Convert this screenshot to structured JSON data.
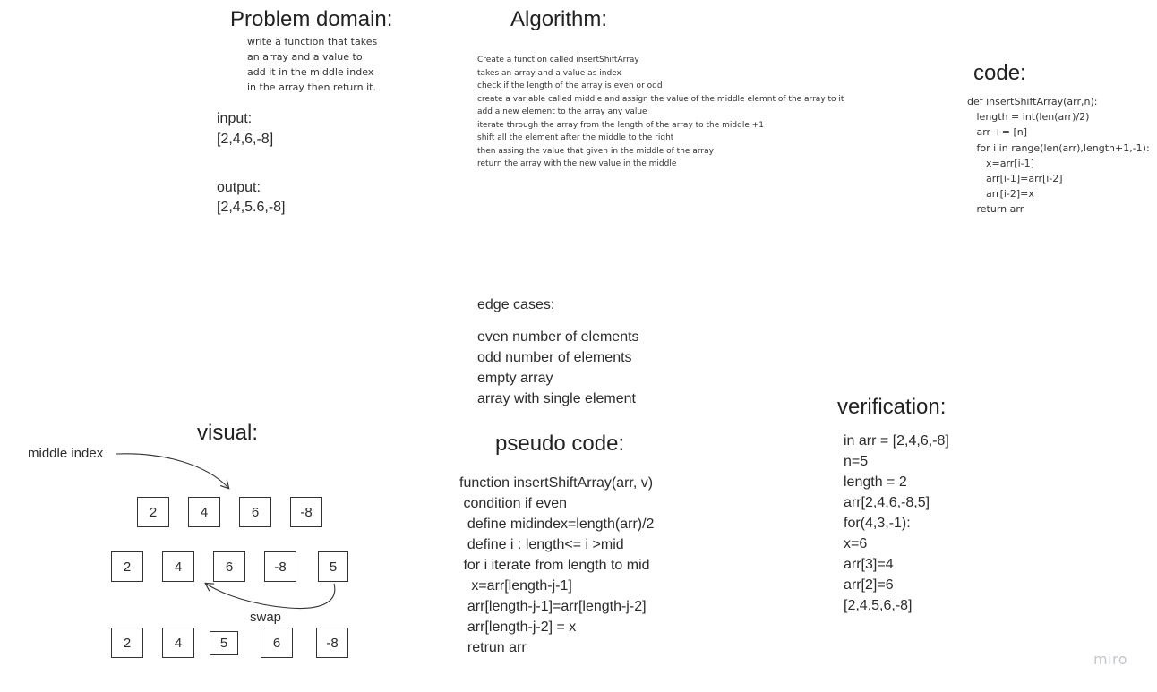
{
  "problem_domain": {
    "title": "Problem domain:",
    "lines": [
      "write a function that takes",
      "an array and a value to",
      "add it in the middle index",
      "in the array then return it."
    ],
    "input_label": "input:",
    "input_value": "[2,4,6,-8]",
    "output_label": "output:",
    "output_value": "[2,4,5.6,-8]"
  },
  "algorithm": {
    "title": "Algorithm:",
    "lines": [
      "Create a function called insertShiftArray",
      "takes an array and a value as index",
      "check if the length of the array is even or odd",
      "create a variable called middle and assign the value of the middle elemnt of the array to it",
      "add a new element to the array any value",
      "iterate through the array from the  length of the array to the middle +1",
      "shift all the element after the middle to the right",
      "then assing the value that given in the middle of the array",
      "return the array with the new value in the middle"
    ]
  },
  "code": {
    "title": "code:",
    "lines": [
      "def insertShiftArray(arr,n):",
      "   length = int(len(arr)/2)",
      "   arr += [n]",
      "   for i in range(len(arr),length+1,-1):",
      "      x=arr[i-1]",
      "      arr[i-1]=arr[i-2]",
      "      arr[i-2]=x",
      "   return arr"
    ]
  },
  "edge_cases": {
    "title": "edge cases:",
    "lines": [
      "even number of elements",
      "odd number of elements",
      "empty array",
      "array with single element"
    ]
  },
  "visual": {
    "title": "visual:",
    "middle_index_label": "middle index",
    "swap_label": "swap",
    "row1": [
      "2",
      "4",
      "6",
      "-8"
    ],
    "row2": [
      "2",
      "4",
      "6",
      "-8",
      "5"
    ],
    "row3": [
      "2",
      "4",
      "5",
      "6",
      "-8"
    ]
  },
  "pseudo_code": {
    "title": "pseudo code:",
    "lines": [
      "function insertShiftArray(arr, v)",
      " condition if even",
      "  define midindex=length(arr)/2",
      "  define i : length<= i >mid",
      " for i iterate from length to mid",
      "   x=arr[length-j-1]",
      "  arr[length-j-1]=arr[length-j-2]",
      "  arr[length-j-2] = x",
      "  retrun arr"
    ]
  },
  "verification": {
    "title": "verification:",
    "lines": [
      "in arr = [2,4,6,-8]",
      "n=5",
      "length = 2",
      "arr[2,4,6,-8,5]",
      "for(4,3,-1):",
      "x=6",
      "arr[3]=4",
      "arr[2]=6",
      "[2,4,5,6,-8]"
    ]
  },
  "watermark": "miro"
}
